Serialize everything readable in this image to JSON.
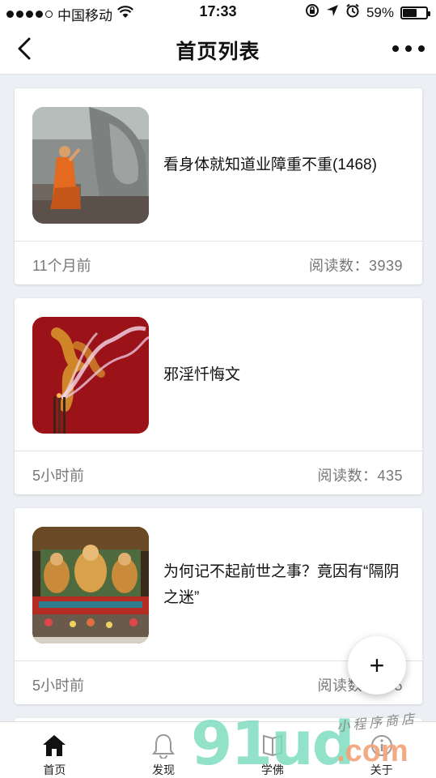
{
  "status_bar": {
    "carrier": "中国移动",
    "time": "17:33",
    "battery": "59%",
    "battery_level": 0.59,
    "icons": [
      "signal-dots",
      "wifi-icon",
      "lock-rotation-icon",
      "location-icon",
      "alarm-icon",
      "battery-icon"
    ]
  },
  "nav": {
    "title": "首页列表",
    "back_icon": "chevron-left-icon",
    "more_icon": "more-dots-icon"
  },
  "articles": [
    {
      "title": "看身体就知道业障重不重(1468)",
      "time": "11个月前",
      "reads": "阅读数：3939",
      "thumb": "monk-praying-image"
    },
    {
      "title": "邪淫忏悔文",
      "time": "5小时前",
      "reads": "阅读数：435",
      "thumb": "incense-smoke-image"
    },
    {
      "title": "为何记不起前世之事？竟因有“隔阴之迷”",
      "time": "5小时前",
      "reads": "阅读数：435",
      "thumb": "temple-statues-image"
    }
  ],
  "fab": {
    "label": "+"
  },
  "tabs": [
    {
      "label": "首页",
      "icon": "home-icon"
    },
    {
      "label": "发现",
      "icon": "bell-icon"
    },
    {
      "label": "学佛",
      "icon": "book-icon"
    },
    {
      "label": "关于",
      "icon": "info-icon"
    }
  ],
  "watermark": {
    "big": "91ud",
    "com": ".com",
    "small": "小程序商店"
  },
  "colors": {
    "background": "#eceff3",
    "card": "#ffffff",
    "text_muted": "#777777",
    "watermark_green": "#7fdcc0",
    "watermark_orange": "#f2a37a"
  }
}
